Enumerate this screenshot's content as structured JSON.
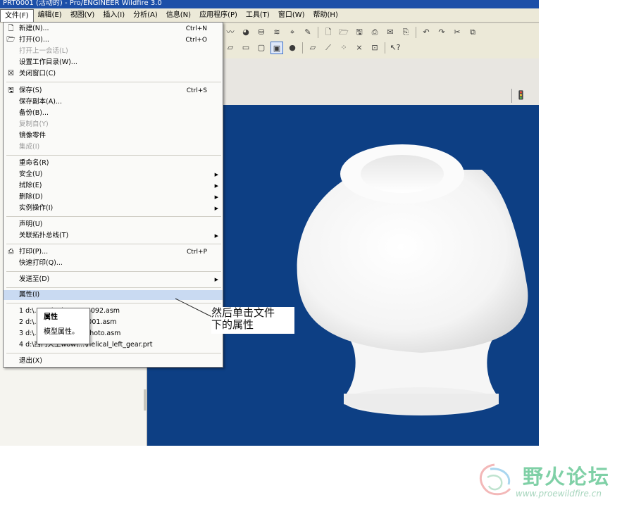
{
  "window": {
    "title": "PRT0001 (活动的) - Pro/ENGINEER Wildfire 3.0"
  },
  "menubar": {
    "items": [
      {
        "label": "文件(F)"
      },
      {
        "label": "编辑(E)"
      },
      {
        "label": "视图(V)"
      },
      {
        "label": "插入(I)"
      },
      {
        "label": "分析(A)"
      },
      {
        "label": "信息(N)"
      },
      {
        "label": "应用程序(P)"
      },
      {
        "label": "工具(T)"
      },
      {
        "label": "窗口(W)"
      },
      {
        "label": "帮助(H)"
      }
    ]
  },
  "file_menu": {
    "new": {
      "label": "新建(N)...",
      "shortcut": "Ctrl+N"
    },
    "open": {
      "label": "打开(O)...",
      "shortcut": "Ctrl+O"
    },
    "open_last_session": {
      "label": "打开上一会话(L)"
    },
    "set_working_dir": {
      "label": "设置工作目录(W)..."
    },
    "close_window": {
      "label": "关闭窗口(C)"
    },
    "save": {
      "label": "保存(S)",
      "shortcut": "Ctrl+S"
    },
    "save_copy": {
      "label": "保存副本(A)..."
    },
    "backup": {
      "label": "备份(B)..."
    },
    "copy_from": {
      "label": "复制自(Y)"
    },
    "mirror_part": {
      "label": "镜像零件"
    },
    "integrate": {
      "label": "集成(I)"
    },
    "rename": {
      "label": "重命名(R)"
    },
    "instance": {
      "label": "安全(U)"
    },
    "erase": {
      "label": "拭除(E)"
    },
    "delete": {
      "label": "删除(D)"
    },
    "instance_ops": {
      "label": "实例操作(I)"
    },
    "declare": {
      "label": "声明(U)"
    },
    "topology_bus": {
      "label": "关联拓扑总线(T)"
    },
    "print": {
      "label": "打印(P)...",
      "shortcut": "Ctrl+P"
    },
    "quick_print": {
      "label": "快速打印(Q)..."
    },
    "send_to": {
      "label": "发送至(D)"
    },
    "properties": {
      "label": "属性(I)"
    },
    "recent": [
      {
        "label": "1 d:\\...\\sp(go)\\3D1\\06092.asm"
      },
      {
        "label": "2 d:\\...\\克风\\3d\\asm0001.asm"
      },
      {
        "label": "3 d:\\...\\京风\\3d\\micophoto.asm"
      },
      {
        "label": "4 d:\\西门大王wow\\...\\helical_left_gear.prt"
      }
    ],
    "exit": {
      "label": "退出(X)"
    }
  },
  "tooltip": {
    "line1": "属性",
    "line2": "模型属性。"
  },
  "annotation": {
    "line1": "然后单击文件",
    "line2": "下的属性"
  },
  "watermark": {
    "title": "野火论坛",
    "url": "www.proewildfire.cn"
  },
  "colors": {
    "viewport_bg": "#0d3f84",
    "highlight": "#c9daf2",
    "titlebar": "#1c4fa8",
    "watermark_green": "#7fd0a6"
  }
}
